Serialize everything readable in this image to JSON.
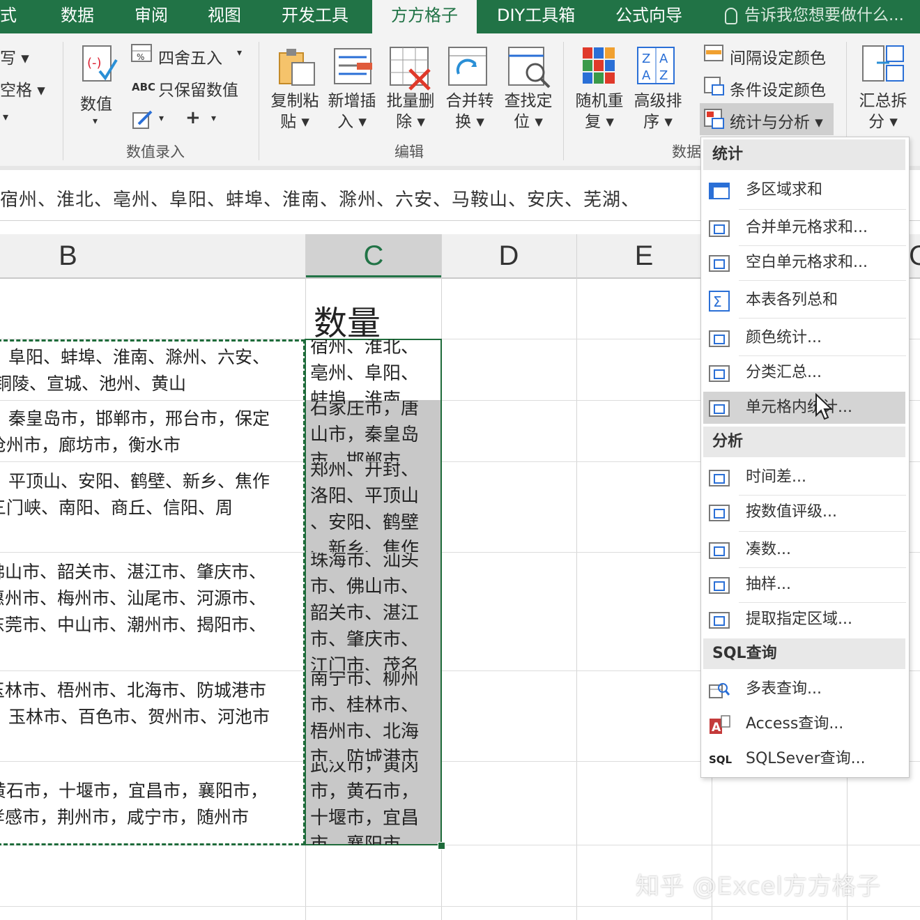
{
  "ribbon_tabs": [
    "式",
    "数据",
    "审阅",
    "视图",
    "开发工具",
    "方方格子",
    "DIY工具箱",
    "公式向导"
  ],
  "active_tab": "方方格子",
  "tell_me": "告诉我您想要做什么...",
  "ribbon": {
    "left_partial": [
      "写 ▾",
      "空格 ▾",
      "▾"
    ],
    "numeric_label": "数值",
    "round_label": "四舍五入",
    "keep_value_label": "只保留数值",
    "abc_label": "ABC",
    "plus_label": "+",
    "group_input": "数值录入",
    "buttons": [
      {
        "l1": "复制粘",
        "l2": "贴 ▾"
      },
      {
        "l1": "新增插",
        "l2": "入 ▾"
      },
      {
        "l1": "批量删",
        "l2": "除 ▾"
      },
      {
        "l1": "合并转",
        "l2": "换 ▾"
      },
      {
        "l1": "查找定",
        "l2": "位 ▾"
      },
      {
        "l1": "随机重",
        "l2": "复 ▾"
      },
      {
        "l1": "高级排",
        "l2": "序 ▾"
      }
    ],
    "group_edit": "编辑",
    "group_data": "数据",
    "interval_color": "间隔设定颜色",
    "cond_color": "条件设定颜色",
    "stats_analysis": "统计与分析 ▾",
    "summary_split": {
      "l1": "汇总拆",
      "l2": "分 ▾"
    }
  },
  "formula_text": "宿州、淮北、亳州、阜阳、蚌埠、淮南、滁州、六安、马鞍山、安庆、芜湖、",
  "columns": [
    "B",
    "C",
    "D",
    "E"
  ],
  "column_partial": "G",
  "header_cell": "数量",
  "b_cells": [
    [
      "阜阳、蚌埠、淮南、滁州、六安、",
      "铜陵、宣城、池州、黄山"
    ],
    [
      "秦皇岛市，邯郸市，邢台市，保定",
      "沧州市，廊坊市，衡水市"
    ],
    [
      "平顶山、安阳、鹤壁、新乡、焦作",
      "三门峡、南阳、商丘、信阳、周"
    ],
    [
      "佛山市、韶关市、湛江市、肇庆市、",
      "惠州市、梅州市、汕尾市、河源市、",
      "东莞市、中山市、潮州市、揭阳市、"
    ],
    [
      "玉林市、梧州市、北海市、防城港市",
      "玉林市、百色市、贺州市、河池市"
    ],
    [
      "黄石市，十堰市，宜昌市，襄阳市，",
      "孝感市，荆州市，咸宁市，随州市"
    ]
  ],
  "c_cells": [
    [
      "宿州、淮北、",
      "亳州、阜阳、",
      "蚌埠、淮南"
    ],
    [
      "石家庄市，唐",
      "山市，秦皇岛",
      "市，邯郸市"
    ],
    [
      "郑州、开封、",
      "洛阳、平顶山",
      "、安阳、鹤壁",
      "、新乡、焦作"
    ],
    [
      "珠海市、汕头",
      "市、佛山市、",
      "韶关市、湛江",
      "市、肇庆市、",
      "江门市、茂名"
    ],
    [
      "南宁市、柳州",
      "市、桂林市、",
      "梧州市、北海",
      "市、防城港市"
    ],
    [
      "武汉市，黄冈",
      "市，黄石市，",
      "十堰市，宜昌",
      "市，襄阳市"
    ]
  ],
  "menu": {
    "sections": [
      {
        "title": "统计",
        "items": [
          "多区域求和",
          "合并单元格求和...",
          "空白单元格求和...",
          "本表各列总和",
          "颜色统计...",
          "分类汇总...",
          "单元格内统计..."
        ]
      },
      {
        "title": "分析",
        "items": [
          "时间差...",
          "按数值评级...",
          "凑数...",
          "抽样...",
          "提取指定区域..."
        ]
      },
      {
        "title": "SQL查询",
        "items": [
          "多表查询...",
          "Access查询...",
          "SQLSever查询..."
        ]
      }
    ],
    "highlighted": "单元格内统计...",
    "sql_icon_text": "SQL",
    "access_icon_text": "A"
  },
  "watermark": "知乎 @Excel方方格子",
  "colors": {
    "excel_green": "#217346",
    "selection_border": "#1e6b3a",
    "selection_fill": "#c8c8c8"
  }
}
